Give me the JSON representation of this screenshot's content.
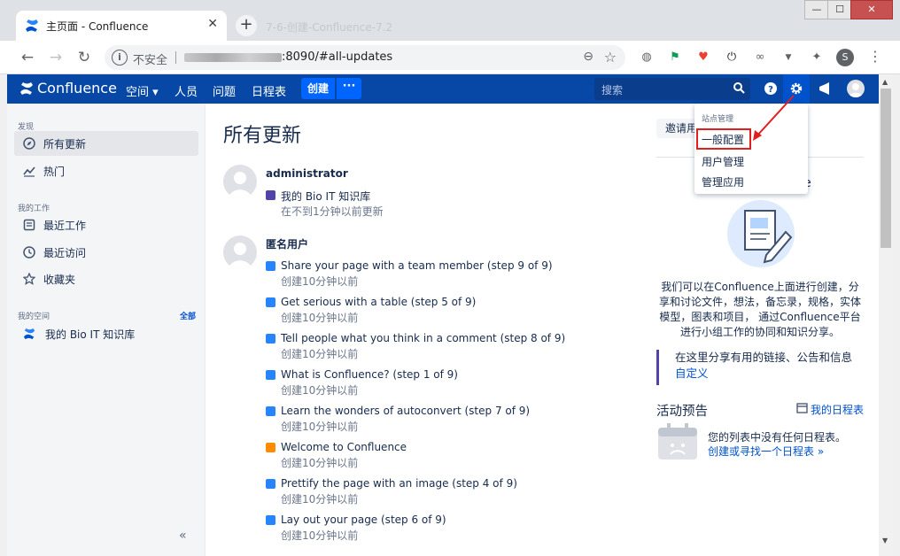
{
  "browser": {
    "tab_title": "主页面 - Confluence",
    "tab_close": "✕",
    "new_tab": "+",
    "ghost_title": "7-6-创建-Confluence-7.2",
    "omnibox_security": "不安全",
    "omnibox_url": ":8090/#all-updates",
    "profile_initial": "S",
    "window_min": "—",
    "window_max": "☐",
    "window_close": "✕"
  },
  "header": {
    "logo_text": "Confluence",
    "nav": [
      "空间 ▾",
      "人员",
      "问题",
      "日程表"
    ],
    "create_label": "创建",
    "more_label": "···",
    "search_placeholder": "搜索"
  },
  "sidebar": {
    "discover_heading": "发现",
    "discover_items": [
      "所有更新",
      "热门"
    ],
    "mywork_heading": "我的工作",
    "mywork_items": [
      "最近工作",
      "最近访问",
      "收藏夹"
    ],
    "spaces_heading": "我的空间",
    "spaces_all": "全部",
    "spaces_items": [
      "我的 Bio IT 知识库"
    ],
    "collapse": "«"
  },
  "main": {
    "title": "所有更新",
    "feed": [
      {
        "user": "administrator",
        "entries": [
          {
            "title": "我的 Bio IT 知识库",
            "time": "在不到1分钟以前更新",
            "type": "space"
          }
        ]
      },
      {
        "user": "匿名用户",
        "entries": [
          {
            "title": "Share your page with a team member (step 9 of 9)",
            "time": "创建10分钟以前",
            "type": "page"
          },
          {
            "title": "Get serious with a table (step 5 of 9)",
            "time": "创建10分钟以前",
            "type": "page"
          },
          {
            "title": "Tell people what you think in a comment (step 8 of 9)",
            "time": "创建10分钟以前",
            "type": "page"
          },
          {
            "title": "What is Confluence? (step 1 of 9)",
            "time": "创建10分钟以前",
            "type": "page"
          },
          {
            "title": "Learn the wonders of autoconvert (step 7 of 9)",
            "time": "创建10分钟以前",
            "type": "page"
          },
          {
            "title": "Welcome to Confluence",
            "time": "创建10分钟以前",
            "type": "home"
          },
          {
            "title": "Prettify the page with an image (step 4 of 9)",
            "time": "创建10分钟以前",
            "type": "page"
          },
          {
            "title": "Lay out your page (step 6 of 9)",
            "time": "创建10分钟以前",
            "type": "page"
          }
        ]
      }
    ]
  },
  "right": {
    "invite_label": "邀请用户",
    "welcome_partial": "ence",
    "description": "我们可以在Confluence上面进行创建，分享和讨论文件，想法，备忘录，规格，实体模型，图表和项目， 通过Confluence平台进行小组工作的协同和知识分享。",
    "share_text": "在这里分享有用的链接、公告和信息",
    "share_link": "自定义",
    "activity_title": "活动预告",
    "my_calendar_link": "我的日程表",
    "empty_text": "您的列表中没有任何日程表。",
    "empty_link": "创建或寻找一个日程表 »"
  },
  "dropdown": {
    "heading": "站点管理",
    "items": [
      "一般配置",
      "用户管理",
      "管理应用"
    ]
  },
  "colors": {
    "header": "#0747a6",
    "accent": "#0052cc",
    "highlight": "#e02020"
  }
}
